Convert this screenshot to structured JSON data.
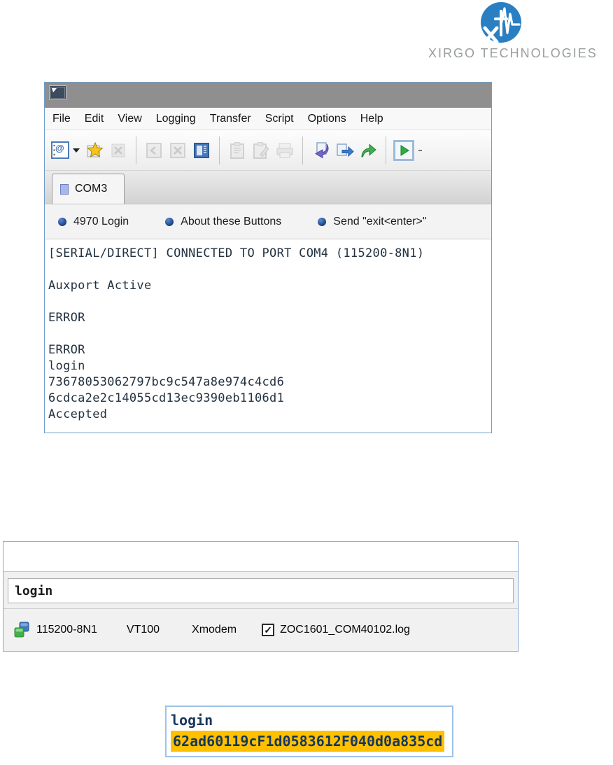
{
  "logo": {
    "brand": "XIRGO TECHNOLOGIES",
    "monogram": "xt",
    "circle_color": "#2a7fc2"
  },
  "icons": {
    "at_glyph": "@",
    "checkmark": "✓"
  },
  "zoc_terminal": {
    "menu_items": [
      "File",
      "Edit",
      "View",
      "Logging",
      "Transfer",
      "Script",
      "Options",
      "Help"
    ],
    "toolbar_icons": [
      "phonebook-connect",
      "dropdown-caret",
      "new-favorite",
      "delete-favorite",
      "window-previous",
      "window-close",
      "window-list",
      "paste",
      "clipboard-edit",
      "print",
      "reply-arrow",
      "send-file",
      "run-script",
      "play-script"
    ],
    "tab_label": "COM3",
    "quick_buttons": [
      "4970 Login",
      "About these Buttons",
      "Send \"exit<enter>\""
    ],
    "output": "[SERIAL/DIRECT] CONNECTED TO PORT COM4 (115200-8N1)\n\nAuxport Active\n\nERROR\n\nERROR\nlogin\n73678053062797bc9c547a8e974c4cd6\n6cdca2e2c14055cd13ec9390eb1106d1\nAccepted"
  },
  "command_window": {
    "input_value": "login",
    "status_bar": {
      "connection": "115200-8N1",
      "emulation": "VT100",
      "protocol": "Xmodem",
      "log_checked": true,
      "log_file": "ZOC1601_COM40102.log"
    }
  },
  "highlight_box": {
    "command": "login",
    "response_hash": "62ad60119cF1d0583612F040d0a835cd",
    "highlight_color": "#ffc000",
    "text_color": "#17375e"
  }
}
